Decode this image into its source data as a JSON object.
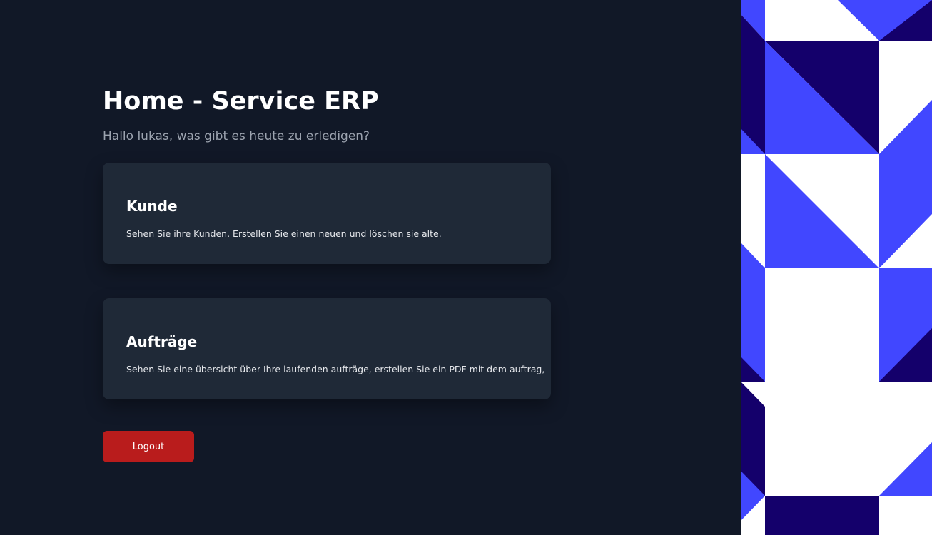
{
  "header": {
    "title": "Home - Service ERP",
    "greeting": "Hallo lukas, was gibt es heute zu erledigen?"
  },
  "cards": [
    {
      "title": "Kunde",
      "description": "Sehen Sie ihre Kunden. Erstellen Sie einen neuen und löschen sie alte."
    },
    {
      "title": "Aufträge",
      "description": "Sehen Sie eine übersicht über Ihre laufenden aufträge, erstellen Sie ein PDF mit dem auftrag,"
    }
  ],
  "actions": {
    "logout_label": "Logout"
  },
  "colors": {
    "background": "#111827",
    "card": "#1f2937",
    "logout": "#b91c1c",
    "pattern_blue": "#4147ff",
    "pattern_navy": "#14006b",
    "pattern_white": "#ffffff"
  }
}
